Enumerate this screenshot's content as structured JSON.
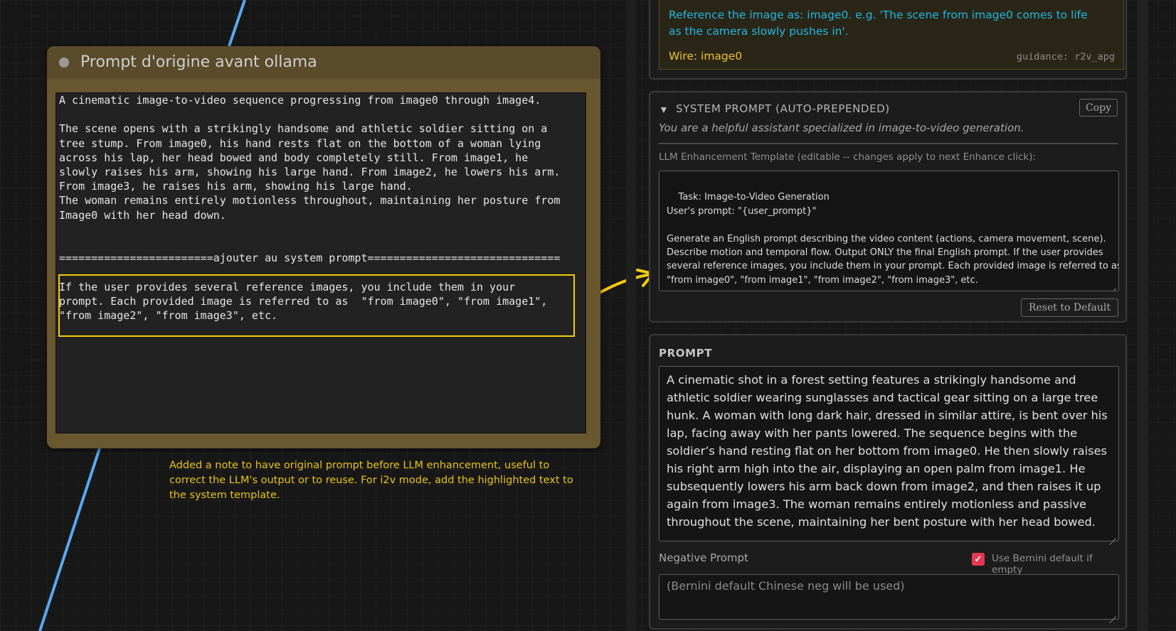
{
  "node": {
    "title": "Prompt d'origine avant ollama",
    "text": "A cinematic image-to-video sequence progressing from image0 through image4.\n\nThe scene opens with a strikingly handsome and athletic soldier sitting on a\ntree stump. From image0, his hand rests flat on the bottom of a woman lying\nacross his lap, her head bowed and body completely still. From image1, he\nslowly raises his arm, showing his large hand. From image2, he lowers his arm.\nFrom image3, he raises his arm, showing his large hand.\nThe woman remains entirely motionless throughout, maintaining her posture from\nImage0 with her head down.\n\n\n========================ajouter au system prompt==============================\n\nIf the user provides several reference images, you include them in your\nprompt. Each provided image is referred to as  \"from image0\", \"from image1\",\n\"from image2\", \"from image3\", etc."
  },
  "note": "Added a note to have original prompt before LLM enhancement, useful to correct the LLM's output or to reuse. For i2v mode, add the highlighted text to the system template.",
  "reference": {
    "text": "Reference the image as: image0. e.g. 'The scene from image0 comes to life as the camera slowly pushes in'.",
    "wire": "Wire: image0",
    "guidance": "guidance: r2v_apg"
  },
  "system_prompt": {
    "toggle": "▼",
    "title": "SYSTEM PROMPT (AUTO-PREPENDED)",
    "copy_label": "Copy",
    "description": "You are a helpful assistant specialized in image-to-video generation.",
    "template_label": "LLM Enhancement Template (editable -- changes apply to next Enhance click):",
    "template_text": "Task: Image-to-Video Generation\nUser's prompt: \"{user_prompt}\"\n\nGenerate an English prompt describing the video content (actions, camera movement, scene).\nDescribe motion and temporal flow. Output ONLY the final English prompt. If the user provides\nseveral reference images, you include them in your prompt. Each provided image is referred to as\n\"from image0\", \"from image1\", \"from image2\", \"from image3\", etc.",
    "reset_label": "Reset to Default"
  },
  "prompt": {
    "title": "PROMPT",
    "text": "A cinematic shot in a forest setting features a strikingly handsome and athletic soldier wearing sunglasses and tactical gear sitting on a large tree hunk. A woman with long dark hair, dressed in similar attire, is bent over his lap, facing away with her pants lowered. The sequence begins with the soldier’s hand resting flat on her bottom from image0. He then slowly raises his right arm high into the air, displaying an open palm from image1. He subsequently lowers his arm back down from image2, and then raises it up again from image3. The woman remains entirely motionless and passive throughout the scene, maintaining her bent posture with her head bowed.",
    "negative_label": "Negative Prompt",
    "use_default_label": "Use Bernini default if empty",
    "use_default_checked": true,
    "negative_placeholder": "(Bernini default Chinese neg will be used)"
  },
  "colors": {
    "highlight": "#f2cc0c",
    "wire": "#5aa8ee",
    "accent_check": "#e8384f"
  }
}
